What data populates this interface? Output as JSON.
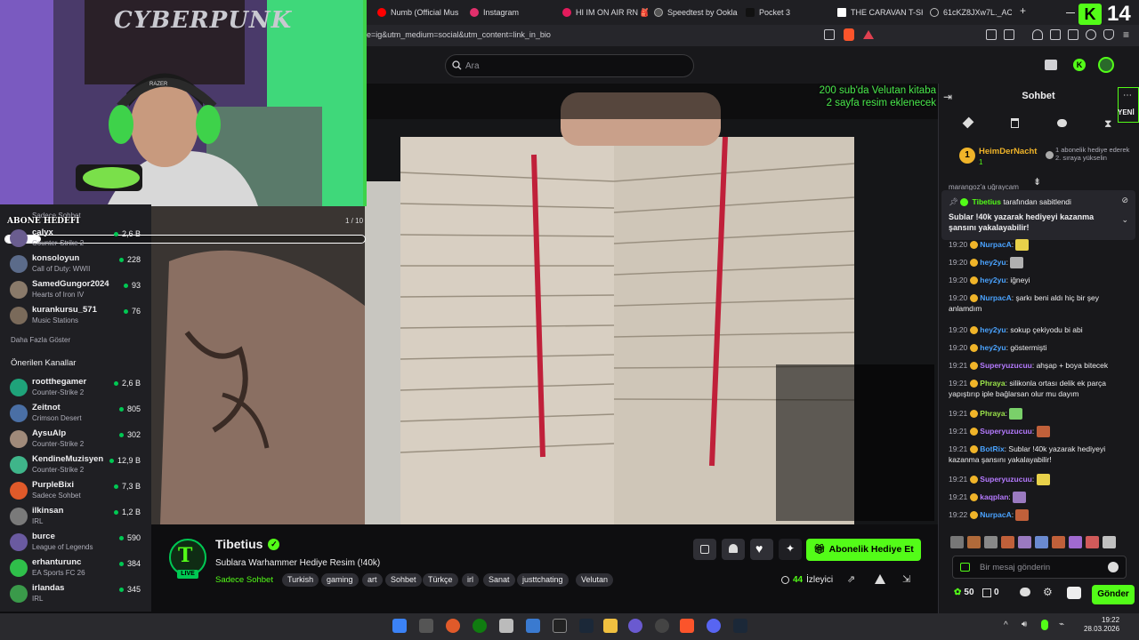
{
  "browser": {
    "tabs": [
      {
        "label": "Numb (Official Mus",
        "color": "#ff0000"
      },
      {
        "label": "Instagram",
        "color": "#e1306c"
      },
      {
        "label": "HI IM ON AIR RN 🎒",
        "color": "#e31b5c"
      },
      {
        "label": "Speedtest by Ookla",
        "color": "#aaaaaa"
      },
      {
        "label": "Pocket 3",
        "color": "#222222"
      },
      {
        "label": "THE CARAVAN T-SH",
        "color": "#ffffff"
      },
      {
        "label": "61cKZ8JXw7L._AC_",
        "color": "#bbbbbb"
      }
    ],
    "new_tab": "+",
    "url": "e=ig&utm_medium=social&utm_content=link_in_bio",
    "corner_number": "14"
  },
  "topnav": {
    "search_placeholder": "Ara"
  },
  "webcam": {
    "poster_text": "CYBERPUNK",
    "headset_brand": "RAZER"
  },
  "sub_goal": {
    "label": "ABONE HEDEFİ",
    "progress_text": "1 / 10",
    "progress": 0.1
  },
  "sidebar": {
    "partial_top": {
      "game": "Sadece Sohbet"
    },
    "followed": [
      {
        "name": "calyx",
        "game": "Counter-Strike 2",
        "viewers": "2,6 B",
        "color": "#6a5d8f"
      },
      {
        "name": "konsoloyun",
        "game": "Call of Duty: WWII",
        "viewers": "228",
        "color": "#5b6b8a"
      },
      {
        "name": "SamedGungor2024",
        "game": "Hearts of Iron IV",
        "viewers": "93",
        "color": "#8a7a6a"
      },
      {
        "name": "kurankursu_571",
        "game": "Music Stations",
        "viewers": "76",
        "color": "#7a6a5a"
      }
    ],
    "show_more": "Daha Fazla Göster",
    "recommended_header": "Önerilen Kanallar",
    "recommended": [
      {
        "name": "rootthegamer",
        "game": "Counter-Strike 2",
        "viewers": "2,6 B",
        "color": "#1fa37a"
      },
      {
        "name": "Zeitnot",
        "game": "Crimson Desert",
        "viewers": "805",
        "color": "#4a6fa5"
      },
      {
        "name": "AysuAlp",
        "game": "Counter-Strike 2",
        "viewers": "302",
        "color": "#a08a7a"
      },
      {
        "name": "KendineMuzisyen",
        "game": "Counter-Strike 2",
        "viewers": "12,9 B",
        "color": "#3fb58a"
      },
      {
        "name": "PurpleBixi",
        "game": "Sadece Sohbet",
        "viewers": "7,3 B",
        "color": "#e05a2a"
      },
      {
        "name": "ilkinsan",
        "game": "IRL",
        "viewers": "1,2 B",
        "color": "#7a7a7a"
      },
      {
        "name": "burce",
        "game": "League of Legends",
        "viewers": "590",
        "color": "#6a5aa0"
      },
      {
        "name": "erhanturunc",
        "game": "EA Sports FC 26",
        "viewers": "384",
        "color": "#2fbf4a"
      },
      {
        "name": "irlandas",
        "game": "IRL",
        "viewers": "345",
        "color": "#3a9a4a"
      }
    ]
  },
  "video": {
    "overlay_line1": "200 sub'da Velutan kitaba",
    "overlay_line2": "2 sayfa resim eklenecek"
  },
  "stream": {
    "name": "Tibetius",
    "live_label": "LIVE",
    "title": "Sublara Warhammer Hediye Resim (!40k)",
    "category": "Sadece Sohbet",
    "tags": [
      "Turkish",
      "gaming",
      "art",
      "Sohbet",
      "Türkçe",
      "irl",
      "Sanat",
      "justtchating",
      "Velutan"
    ],
    "gift_button": "Abonelik Hediye Et",
    "viewer_count": "44",
    "viewer_label": "İzleyici"
  },
  "chat": {
    "title": "Sohbet",
    "new_label": "YENİ",
    "top_gifter": {
      "rank": "1",
      "name": "HeimDerNacht",
      "count": "1",
      "note": "1 abonelik hediye ederek 2. sıraya yükselin"
    },
    "cut_line": "marangoz'a uğraycam",
    "pinned": {
      "by": "Tibetius",
      "by_suffix": "tarafından sabitlendi",
      "text": "Sublar !40k yazarak hediyeyi kazanma şansını yakalayabilir!"
    },
    "messages": [
      {
        "time": "19:20",
        "user": "NurpacA",
        "color": "#4aa3ff",
        "text": "",
        "emote": "#e8d14a"
      },
      {
        "time": "19:20",
        "user": "hey2yu",
        "color": "#4aa3ff",
        "text": "",
        "emote": "#b0b0b0"
      },
      {
        "time": "19:20",
        "user": "hey2yu",
        "color": "#4aa3ff",
        "text": "iğneyi",
        "emote": ""
      },
      {
        "time": "19:20",
        "user": "NurpacA",
        "color": "#4aa3ff",
        "text": "şarkı beni aldı hiç bir şey anlamdım",
        "emote": ""
      },
      {
        "time": "19:20",
        "user": "hey2yu",
        "color": "#4aa3ff",
        "text": "sokup çekiyodu bi abi",
        "emote": ""
      },
      {
        "time": "19:20",
        "user": "hey2yu",
        "color": "#4aa3ff",
        "text": "göstermişti",
        "emote": ""
      },
      {
        "time": "19:21",
        "user": "Superyuzucuu",
        "color": "#b57aff",
        "text": "ahşap + boya bitecek",
        "emote": ""
      },
      {
        "time": "19:21",
        "user": "Phraya",
        "color": "#9ae34a",
        "text": "silikonla ortası delik ek parça yapıştırıp iple bağlarsan olur mu dayım",
        "emote": ""
      },
      {
        "time": "19:21",
        "user": "Phraya",
        "color": "#9ae34a",
        "text": "",
        "emote": "#7ad06a"
      },
      {
        "time": "19:21",
        "user": "Superyuzucuu",
        "color": "#b57aff",
        "text": "",
        "emote": "#c0603a"
      },
      {
        "time": "19:21",
        "user": "BotRix",
        "color": "#4aa3ff",
        "text": "Sublar !40k yazarak hediyeyi kazanma şansını yakalayabilir!",
        "emote": ""
      },
      {
        "time": "19:21",
        "user": "Superyuzucuu",
        "color": "#b57aff",
        "text": "",
        "emote": "#e8d14a"
      },
      {
        "time": "19:21",
        "user": "kaqplan",
        "color": "#b57aff",
        "text": "",
        "emote": "#9a7ac0"
      },
      {
        "time": "19:22",
        "user": "NurpacA",
        "color": "#4aa3ff",
        "text": "",
        "emote": "#c0603a"
      }
    ],
    "input_placeholder": "Bir mesaj gönderin",
    "points": "50",
    "points2": "0",
    "send_button": "Gönder"
  },
  "taskbar": {
    "time": "19:22",
    "date": "28.03.2026"
  }
}
